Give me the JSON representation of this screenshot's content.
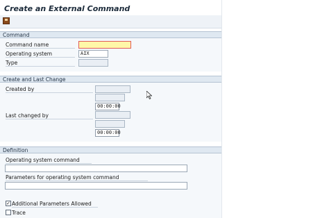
{
  "window": {
    "title": "Create an External Command"
  },
  "toolbar": {
    "save_icon": "save-icon"
  },
  "command": {
    "header": "Command",
    "name_label": "Command name",
    "name_value": "",
    "os_label": "Operating system",
    "os_value": "AIX",
    "type_label": "Type",
    "type_value": ""
  },
  "create_change": {
    "header": "Create and Last Change",
    "created_by_label": "Created by",
    "created_by_value": "",
    "created_date_value": "",
    "created_time_value": "00:00:00",
    "changed_by_label": "Last changed by",
    "changed_by_value": "",
    "changed_date_value": "",
    "changed_time_value": "00:00:00"
  },
  "definition": {
    "header": "Definition",
    "os_command_label": "Operating system command",
    "os_command_value": "",
    "params_label": "Parameters for operating system command",
    "params_value": "",
    "additional_params_label": "Additional Parameters Allowed",
    "additional_params_checked": "✓",
    "trace_label": "Trace",
    "trace_checked": ""
  }
}
